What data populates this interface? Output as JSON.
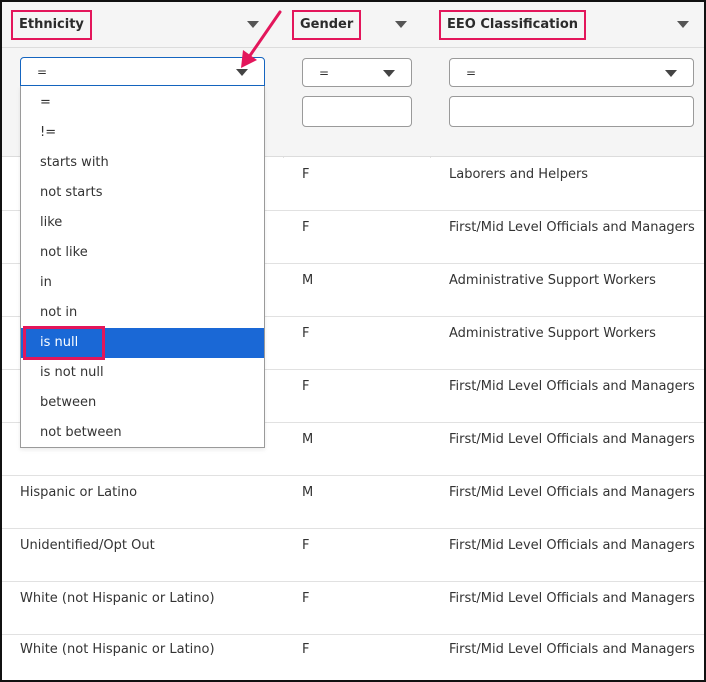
{
  "columns": {
    "ethnicity": "Ethnicity",
    "gender": "Gender",
    "eeo": "EEO Classification"
  },
  "filters": {
    "ethnicity_operator": "=",
    "gender_operator": "=",
    "eeo_operator": "=",
    "gender_value": "",
    "eeo_value": ""
  },
  "operator_options": [
    "=",
    "!=",
    "starts with",
    "not starts",
    "like",
    "not like",
    "in",
    "not in",
    "is null",
    "is not null",
    "between",
    "not between"
  ],
  "selected_option": "is null",
  "rows": [
    {
      "ethnicity": "",
      "gender": "F",
      "eeo": "Laborers and Helpers"
    },
    {
      "ethnicity": "",
      "gender": "F",
      "eeo": "First/Mid Level Officials and Managers"
    },
    {
      "ethnicity": "",
      "gender": "M",
      "eeo": "Administrative Support Workers"
    },
    {
      "ethnicity": "",
      "gender": "F",
      "eeo": "Administrative Support Workers"
    },
    {
      "ethnicity": "",
      "gender": "F",
      "eeo": "First/Mid Level Officials and Managers"
    },
    {
      "ethnicity": "",
      "gender": "M",
      "eeo": "First/Mid Level Officials and Managers"
    },
    {
      "ethnicity": "Hispanic or Latino",
      "gender": "M",
      "eeo": "First/Mid Level Officials and Managers"
    },
    {
      "ethnicity": "Unidentified/Opt Out",
      "gender": "F",
      "eeo": "First/Mid Level Officials and Managers"
    },
    {
      "ethnicity": "White (not Hispanic or Latino)",
      "gender": "F",
      "eeo": "First/Mid Level Officials and Managers"
    },
    {
      "ethnicity": "White (not Hispanic or Latino)",
      "gender": "F",
      "eeo": "First/Mid Level Officials and Managers"
    }
  ],
  "colors": {
    "highlight": "#e3165b",
    "selected": "#1a68d6",
    "header_bg": "#f5f5f5"
  },
  "icons": {
    "column_menu": "chevron-down-icon",
    "annotation": "arrow-annotation"
  }
}
